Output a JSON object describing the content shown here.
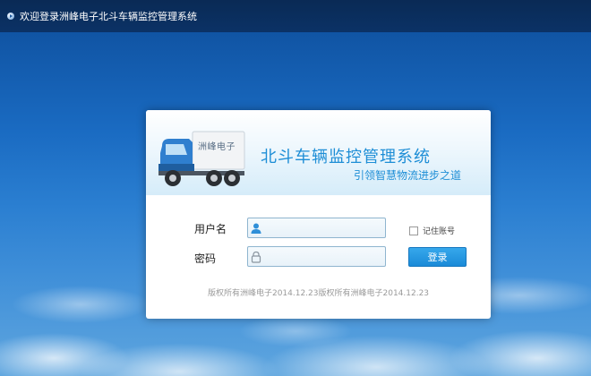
{
  "header": {
    "title": "欢迎登录洲峰电子北斗车辆监控管理系统"
  },
  "banner": {
    "brand_mark": "洲峰电子",
    "system_title": "北斗车辆监控管理系统",
    "slogan": "引领智慧物流进步之道"
  },
  "form": {
    "username_label": "用户名",
    "username_value": "",
    "password_label": "密码",
    "password_value": "",
    "remember_label": "记住账号",
    "remember_checked": false,
    "login_label": "登录"
  },
  "footer": {
    "copyright": "版权所有洲峰电子2014.12.23版权所有洲峰电子2014.12.23"
  },
  "colors": {
    "accent": "#1e8ed6",
    "button": "#1a8ad8",
    "topbar": "#0a2a55"
  },
  "icons": {
    "header": "play-circle-icon",
    "username": "user-icon",
    "password": "lock-icon"
  }
}
